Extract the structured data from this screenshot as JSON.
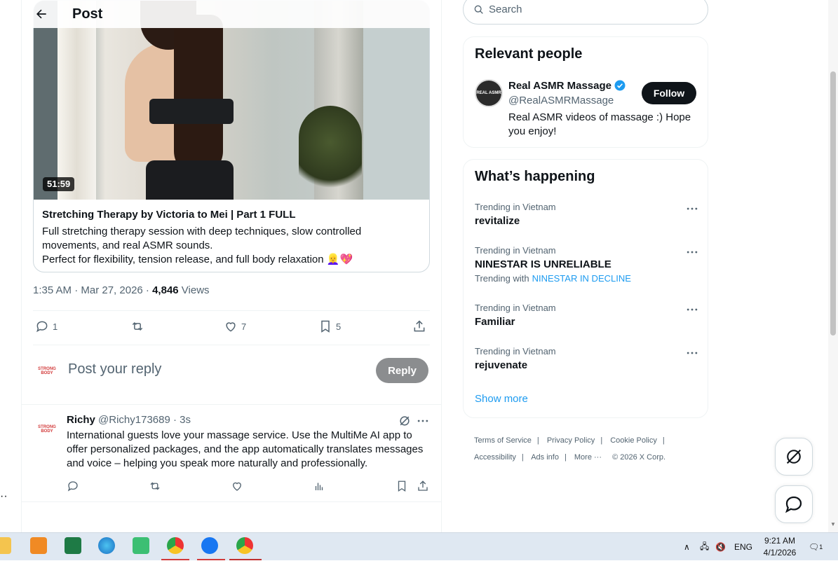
{
  "header": {
    "title": "Post"
  },
  "video": {
    "duration": "51:59",
    "title": "Stretching Therapy by Victoria to Mei | Part 1 FULL",
    "desc_line1": "Full stretching therapy session with deep techniques, slow controlled movements, and real ASMR sounds.",
    "desc_line2": "Perfect for flexibility, tension release, and full body relaxation 👱‍♀️💖"
  },
  "meta": {
    "time": "1:35 AM · Mar 27, 2026 · ",
    "views": "4,846",
    "views_label": " Views"
  },
  "actions": {
    "replies": "1",
    "reposts": "",
    "likes": "7",
    "bookmarks": "5"
  },
  "composer": {
    "placeholder": "Post your reply",
    "reply_button": "Reply",
    "avatar_text": "STRONG BODY"
  },
  "comment": {
    "name": "Richy",
    "handle": "@Richy173689 · 3s",
    "text": "International guests love your massage service. Use the MultiMe AI app to offer personalized packages, and the app automatically translates messages and voice – helping you speak more naturally and professionally."
  },
  "search": {
    "placeholder": "Search"
  },
  "relevant": {
    "title": "Relevant people",
    "name": "Real ASMR Massage",
    "handle": "@RealASMRMassage",
    "bio": "Real ASMR videos of massage :) Hope you enjoy!",
    "follow": "Follow",
    "avatar_text": "REAL ASMR"
  },
  "happening": {
    "title": "What’s happening",
    "trends": [
      {
        "context": "Trending in Vietnam",
        "name": "revitalize"
      },
      {
        "context": "Trending in Vietnam",
        "name": "NINESTAR IS UNRELIABLE",
        "with_label": "Trending with",
        "with_link": "NINESTAR IN DECLINE"
      },
      {
        "context": "Trending in Vietnam",
        "name": "Familiar"
      },
      {
        "context": "Trending in Vietnam",
        "name": "rejuvenate"
      }
    ],
    "show_more": "Show more"
  },
  "footer": {
    "links": [
      "Terms of Service",
      "Privacy Policy",
      "Cookie Policy",
      "Accessibility",
      "Ads info",
      "More ···"
    ],
    "copyright": "© 2026 X Corp."
  },
  "taskbar": {
    "lang": "ENG",
    "time": "9:21 AM",
    "date": "4/1/2026",
    "notif_count": "1"
  },
  "colors": {
    "accent": "#1d9bf0",
    "text": "#0f1419",
    "muted": "#536471",
    "border": "#eff3f4"
  }
}
